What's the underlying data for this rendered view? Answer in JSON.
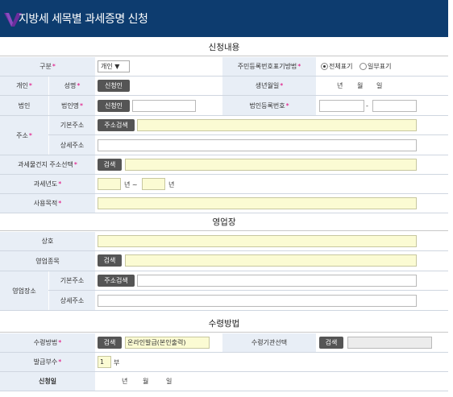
{
  "header": {
    "title": "지방세 세목별 과세증명 신청"
  },
  "sections": {
    "request": "신청내용",
    "business": "영업장",
    "receipt": "수령방법"
  },
  "form": {
    "type_label": "구분",
    "type_value": "개인 ▼",
    "ssn_method_label": "주민등록번호표기방법",
    "ssn_full": "전체표기",
    "ssn_partial": "일부표기",
    "individual_label": "개인",
    "name_label": "성명",
    "applicant_btn": "신청인",
    "birth_label": "생년월일",
    "birth_year": "년",
    "birth_month": "월",
    "birth_day": "일",
    "corp_label": "법인",
    "corp_name_label": "법인명",
    "corp_applicant_btn": "신청인",
    "corp_reg_label": "법인등록번호",
    "corp_reg_dash": "-",
    "address_label": "주소",
    "base_address_label": "기본주소",
    "address_search_btn": "주소검색",
    "detail_address_label": "상세주소",
    "property_address_label": "과세물건지 주소선택",
    "search_btn": "검색",
    "tax_year_label": "과세년도",
    "tax_year_from": "년 ~",
    "tax_year_to": "년",
    "purpose_label": "사용목적"
  },
  "business": {
    "name_label": "상호",
    "type_label": "영업종목",
    "search_btn": "검색",
    "location_label": "영업장소",
    "base_address_label": "기본주소",
    "address_search_btn": "주소검색",
    "detail_address_label": "상세주소"
  },
  "receipt": {
    "method_label": "수령방법",
    "search_btn": "검색",
    "method_value": "온라인발급(본인출력)",
    "agency_label": "수령기관선택",
    "agency_search_btn": "검색",
    "copies_label": "발급부수",
    "copies_value": "1",
    "copies_unit": "부",
    "date_label": "신청일",
    "date_year": "년",
    "date_month": "월",
    "date_day": "일"
  },
  "colors": {
    "header": "#0d3c6f",
    "label_bg": "#e8eef6",
    "required": "#e0007a",
    "button": "#555555",
    "input_highlight": "#fbfbd3"
  }
}
